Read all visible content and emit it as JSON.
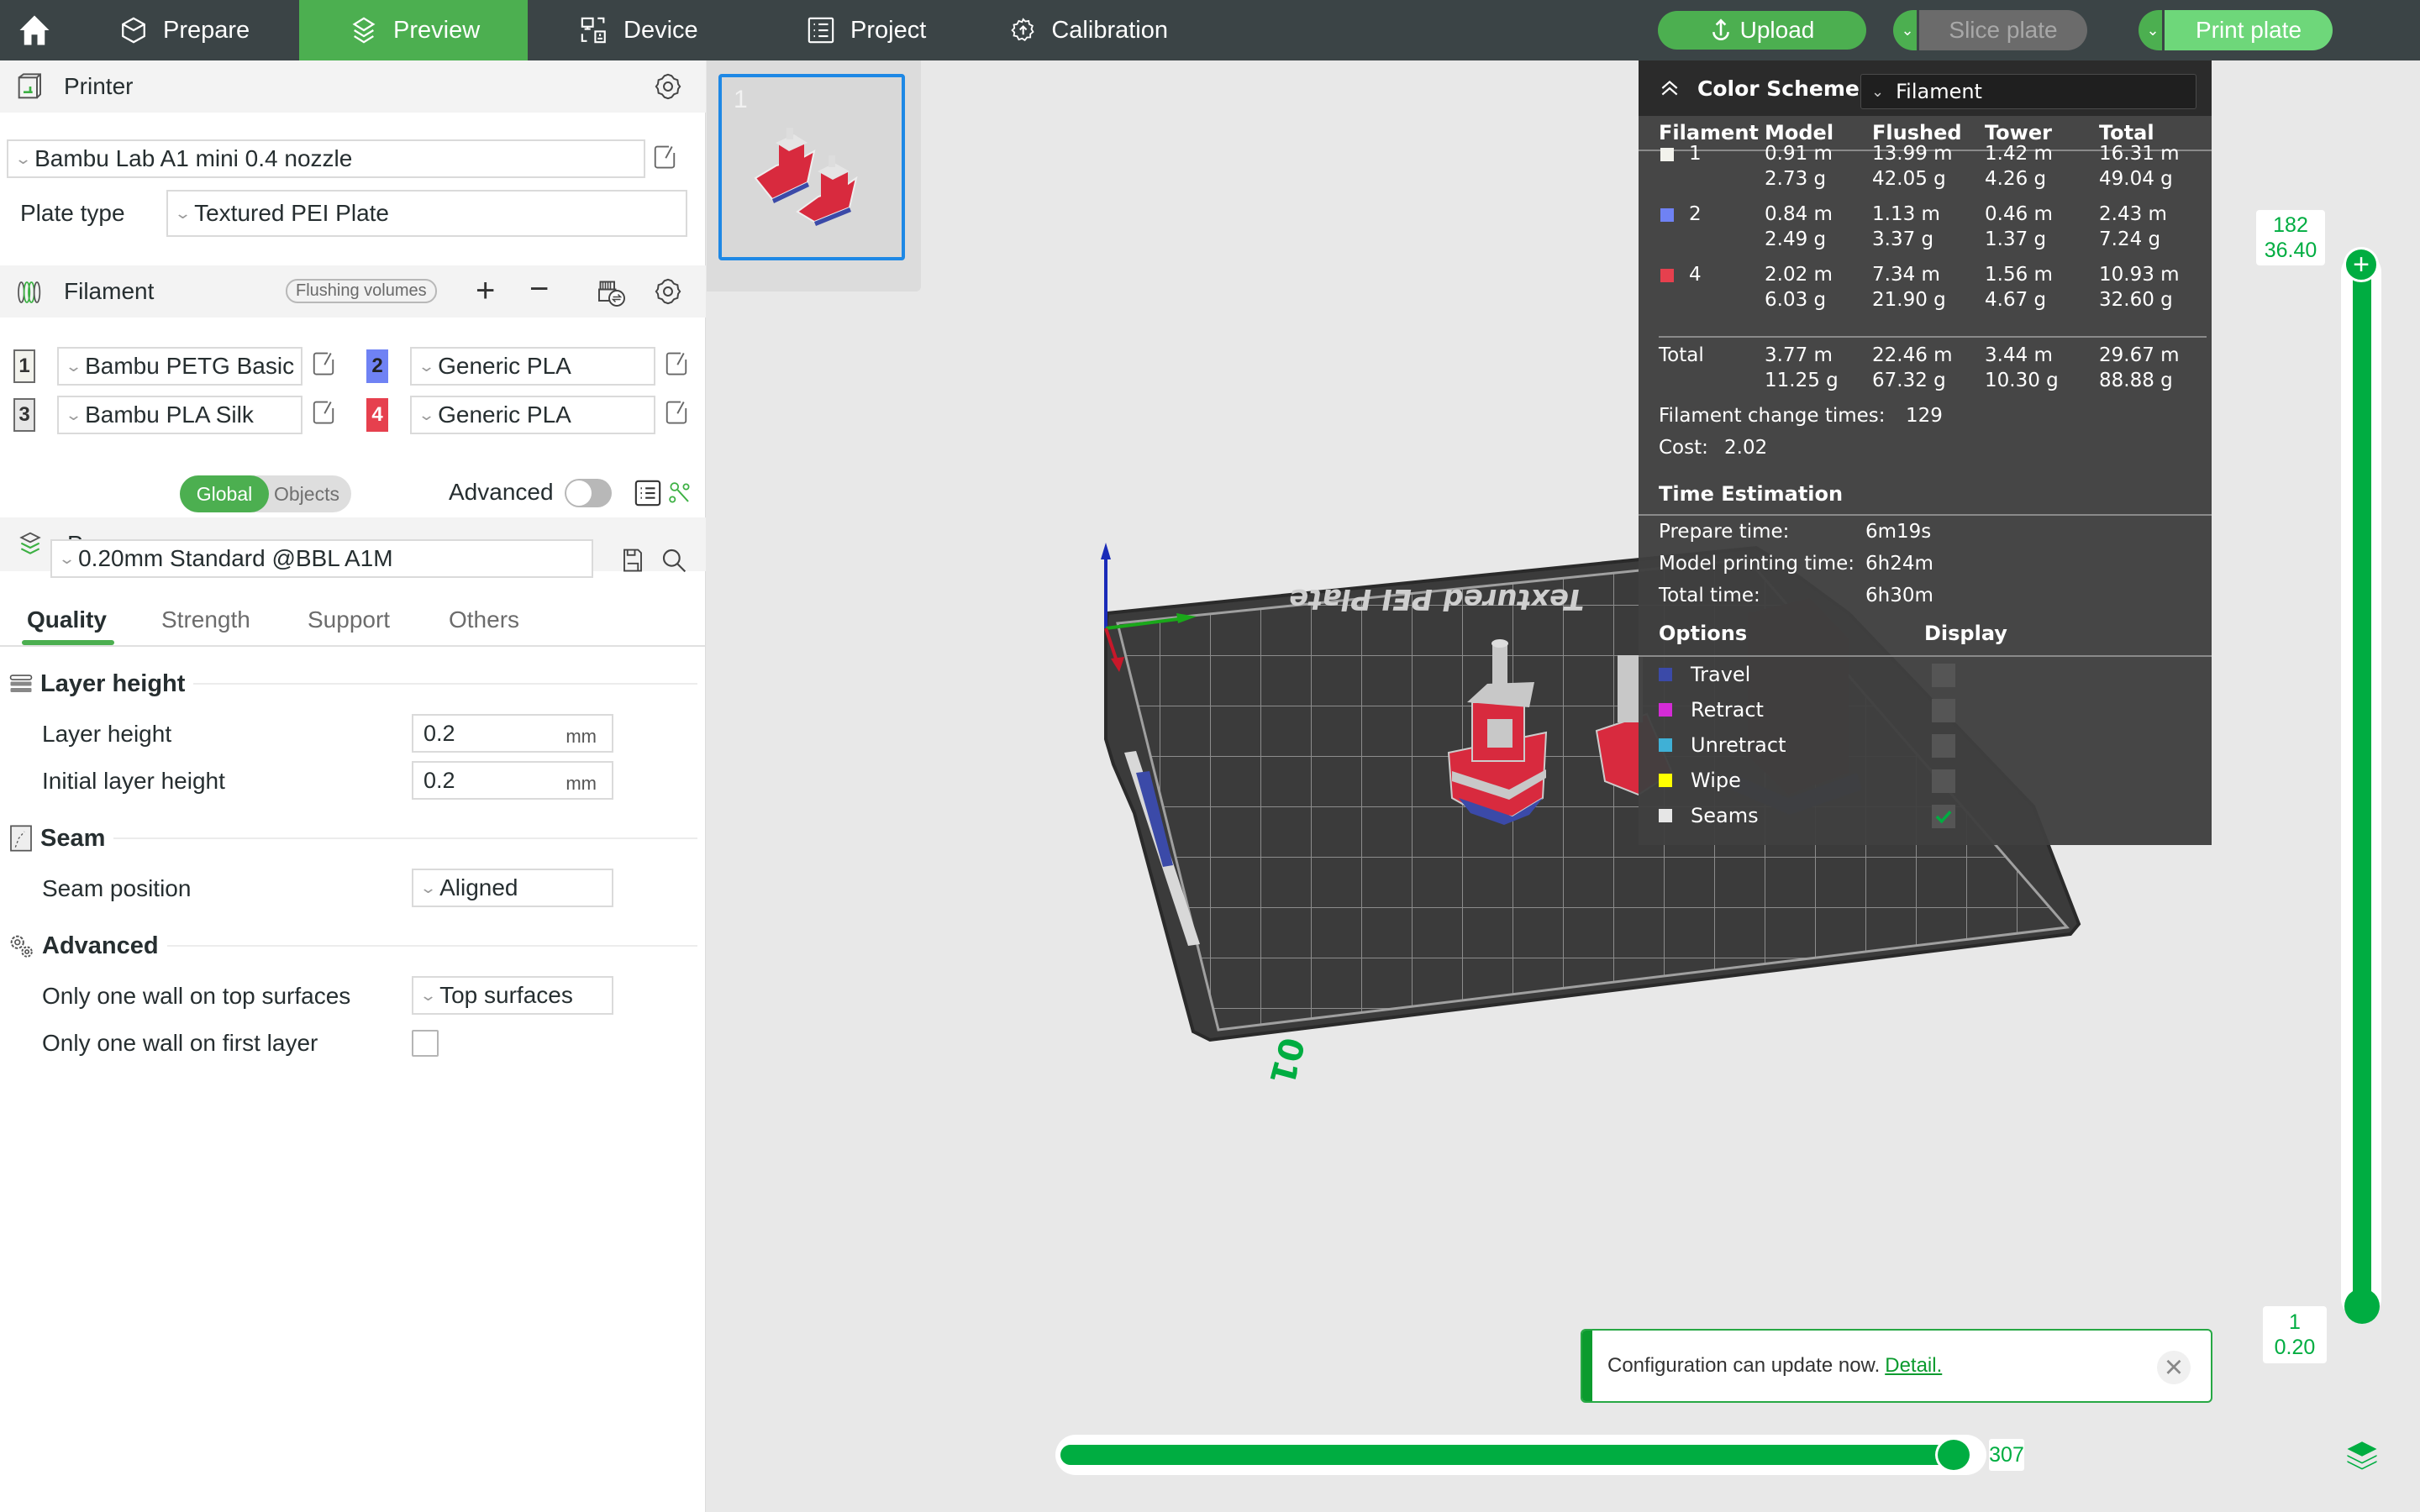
{
  "topbar": {
    "tabs": [
      {
        "label": "Prepare",
        "icon": "cube-icon"
      },
      {
        "label": "Preview",
        "icon": "layers-icon",
        "active": true
      },
      {
        "label": "Device",
        "icon": "device-icon"
      },
      {
        "label": "Project",
        "icon": "list-icon"
      },
      {
        "label": "Calibration",
        "icon": "calibration-gear-icon"
      }
    ],
    "upload_label": "Upload",
    "slice_label": "Slice plate",
    "print_label": "Print plate"
  },
  "printer": {
    "title": "Printer",
    "preset": "Bambu Lab A1 mini 0.4 nozzle",
    "plate_type_label": "Plate type",
    "plate_type": "Textured PEI Plate"
  },
  "filament": {
    "title": "Filament",
    "flushing_label": "Flushing volumes",
    "slots": [
      {
        "num": "1",
        "name": "Bambu PETG Basic",
        "color": "#f2f2ec"
      },
      {
        "num": "2",
        "name": "Generic PLA",
        "color": "#6f82f4"
      },
      {
        "num": "3",
        "name": "Bambu PLA Silk",
        "color": "#e6e6e6"
      },
      {
        "num": "4",
        "name": "Generic PLA",
        "color": "#e6404e"
      }
    ]
  },
  "process": {
    "title": "Process",
    "global_label": "Global",
    "objects_label": "Objects",
    "advanced_label": "Advanced",
    "advanced_on": false,
    "preset": "0.20mm Standard @BBL A1M",
    "tabs": [
      "Quality",
      "Strength",
      "Support",
      "Others"
    ],
    "active_tab": "Quality",
    "groups": {
      "layer_height": {
        "title": "Layer height",
        "layer_height_label": "Layer height",
        "layer_height_value": "0.2",
        "initial_layer_height_label": "Initial layer height",
        "initial_layer_height_value": "0.2",
        "unit": "mm"
      },
      "seam": {
        "title": "Seam",
        "seam_position_label": "Seam position",
        "seam_position_value": "Aligned"
      },
      "advanced": {
        "title": "Advanced",
        "top_wall_label": "Only one wall on top surfaces",
        "top_wall_value": "Top surfaces",
        "first_layer_label": "Only one wall on first layer",
        "first_layer_checked": false
      }
    }
  },
  "plates": [
    {
      "number": "1",
      "selected": true
    }
  ],
  "stats": {
    "color_scheme_label": "Color Scheme",
    "color_scheme_value": "Filament",
    "columns": [
      "Filament",
      "Model",
      "Flushed",
      "Tower",
      "Total"
    ],
    "rows": [
      {
        "filament": "1",
        "color": "#f2f2ec",
        "model": [
          "0.91 m",
          "2.73 g"
        ],
        "flushed": [
          "13.99 m",
          "42.05 g"
        ],
        "tower": [
          "1.42 m",
          "4.26 g"
        ],
        "total": [
          "16.31 m",
          "49.04 g"
        ]
      },
      {
        "filament": "2",
        "color": "#6f82f4",
        "model": [
          "0.84 m",
          "2.49 g"
        ],
        "flushed": [
          "1.13 m",
          "3.37 g"
        ],
        "tower": [
          "0.46 m",
          "1.37 g"
        ],
        "total": [
          "2.43 m",
          "7.24 g"
        ]
      },
      {
        "filament": "4",
        "color": "#e6404e",
        "model": [
          "2.02 m",
          "6.03 g"
        ],
        "flushed": [
          "7.34 m",
          "21.90 g"
        ],
        "tower": [
          "1.56 m",
          "4.67 g"
        ],
        "total": [
          "10.93 m",
          "32.60 g"
        ]
      }
    ],
    "total": {
      "label": "Total",
      "model": [
        "3.77 m",
        "11.25 g"
      ],
      "flushed": [
        "22.46 m",
        "67.32 g"
      ],
      "tower": [
        "3.44 m",
        "10.30 g"
      ],
      "total": [
        "29.67 m",
        "88.88 g"
      ]
    },
    "filament_change_label": "Filament change times:",
    "filament_change_value": "129",
    "cost_label": "Cost:",
    "cost_value": "2.02",
    "time_title": "Time Estimation",
    "prepare_time_label": "Prepare time:",
    "prepare_time_value": "6m19s",
    "model_time_label": "Model printing time:",
    "model_time_value": "6h24m",
    "total_time_label": "Total time:",
    "total_time_value": "6h30m",
    "options_title": "Options",
    "display_title": "Display",
    "options": [
      {
        "label": "Travel",
        "color": "#3b4aa8",
        "checked": false
      },
      {
        "label": "Retract",
        "color": "#d42bd6",
        "checked": false
      },
      {
        "label": "Unretract",
        "color": "#3fb0d6",
        "checked": false
      },
      {
        "label": "Wipe",
        "color": "#ffff00",
        "checked": false
      },
      {
        "label": "Seams",
        "color": "#e6e6e6",
        "checked": true
      }
    ]
  },
  "layer_slider": {
    "top_layer": "182",
    "top_height": "36.40",
    "bottom_layer": "1",
    "bottom_height": "0.20"
  },
  "move_slider": {
    "value": "307",
    "fraction": 0.97
  },
  "notification": {
    "message": "Configuration can update now.",
    "link": "Detail."
  },
  "viewport": {
    "plate_label": "Textured PEI Plate",
    "plate_number": "01"
  },
  "colors": {
    "accent": "#4caf50",
    "slider": "#00ad41",
    "topbar": "#3b4446"
  }
}
